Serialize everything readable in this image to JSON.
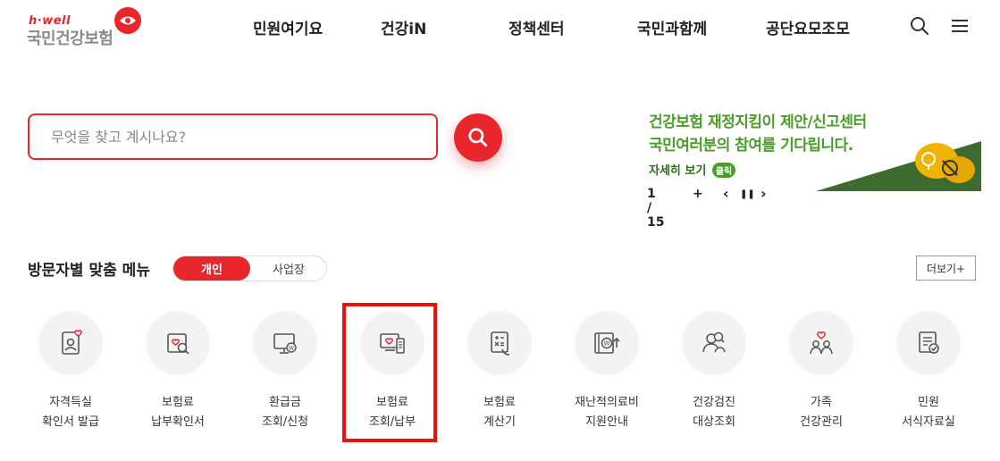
{
  "header": {
    "logo_sub": "h·well",
    "logo_main": "국민건강보험",
    "nav": [
      "민원여기요",
      "건강iN",
      "정책센터",
      "국민과함께",
      "공단요모조모"
    ]
  },
  "search": {
    "placeholder": "무엇을 찾고 계시나요?"
  },
  "banner": {
    "line1": "건강보험 재정지킴이 제안/신고센터",
    "line2": "국민여러분의 참여를 기다립니다.",
    "line3": "자세히 보기",
    "line3_badge": "클릭",
    "pager": "1 / 15",
    "plus": "+",
    "prev": "‹",
    "pause": "❚❚",
    "next": "›"
  },
  "custom_menu": {
    "title": "방문자별 맞춤 메뉴",
    "tab_active": "개인",
    "tab_inactive": "사업장",
    "more": "더보기+",
    "items": [
      {
        "line1": "자격득실",
        "line2": "확인서 발급",
        "icon": "certificate-heart-icon"
      },
      {
        "line1": "보험료",
        "line2": "납부확인서",
        "icon": "document-search-icon"
      },
      {
        "line1": "환급금",
        "line2": "조회/신청",
        "icon": "refund-monitor-icon"
      },
      {
        "line1": "보험료",
        "line2": "조회/납부",
        "icon": "premium-pay-icon"
      },
      {
        "line1": "보험료",
        "line2": "계산기",
        "icon": "calculator-icon"
      },
      {
        "line1": "재난적의료비",
        "line2": "지원안내",
        "icon": "medical-support-icon"
      },
      {
        "line1": "건강검진",
        "line2": "대상조회",
        "icon": "health-checkup-icon"
      },
      {
        "line1": "가족",
        "line2": "건강관리",
        "icon": "family-care-icon"
      },
      {
        "line1": "민원",
        "line2": "서식자료실",
        "icon": "form-document-icon"
      }
    ]
  },
  "colors": {
    "brand_red": "#e8262c",
    "banner_green": "#4a9d2a",
    "highlight_red": "#e8120c"
  }
}
